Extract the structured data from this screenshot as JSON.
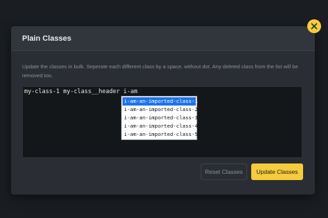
{
  "modal": {
    "title": "Plain Classes",
    "description": "Update the classes in bulk. Seperate each different class by a space, without dot. Any deleted class from the list will be removed too.",
    "editor_value": "my-class-1 my-class__header i-am"
  },
  "autocomplete": {
    "items": [
      "i-am-an-imported-class-1",
      "i-am-an-imported-class-2",
      "i-am-an-imported-class-3",
      "i-am-an-imported-class-4",
      "i-am-an-imported-class-5"
    ],
    "selected_index": 0
  },
  "buttons": {
    "reset_label": "Reset Classes",
    "update_label": "Update Classes"
  },
  "icons": {
    "close": "close-icon"
  },
  "colors": {
    "accent": "#f5cc3c",
    "selection": "#1e73e8"
  }
}
